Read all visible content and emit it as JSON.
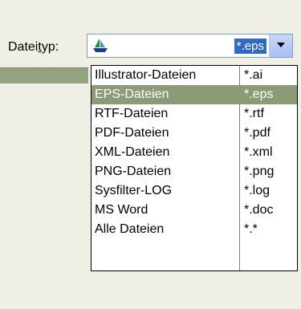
{
  "label": "Dateityp:",
  "combo": {
    "value": "*.eps",
    "icon": "sailboat-icon"
  },
  "options": [
    {
      "name": "Illustrator-Dateien",
      "ext": "*.ai"
    },
    {
      "name": "EPS-Dateien",
      "ext": "*.eps",
      "selected": true
    },
    {
      "name": "RTF-Dateien",
      "ext": "*.rtf"
    },
    {
      "name": "PDF-Dateien",
      "ext": "*.pdf"
    },
    {
      "name": "XML-Dateien",
      "ext": "*.xml"
    },
    {
      "name": "PNG-Dateien",
      "ext": "*.png"
    },
    {
      "name": "Sysfilter-LOG",
      "ext": "*.log"
    },
    {
      "name": "MS Word",
      "ext": "*.doc"
    },
    {
      "name": "Alle Dateien",
      "ext": "*.*"
    }
  ]
}
